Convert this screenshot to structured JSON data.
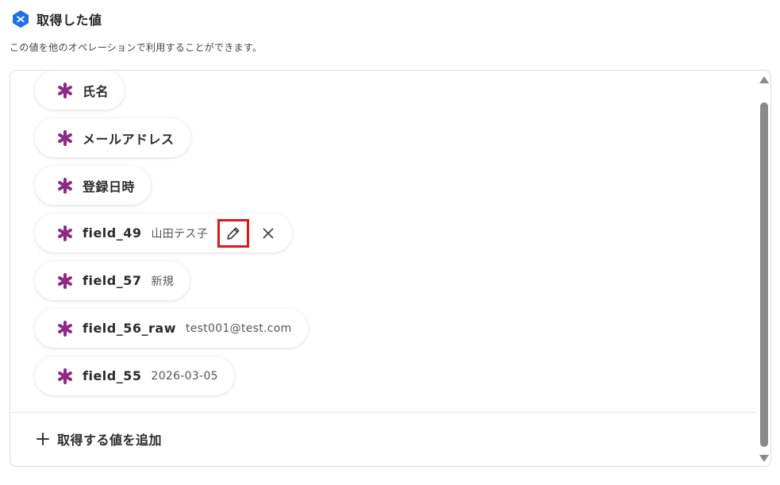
{
  "header": {
    "title": "取得した値",
    "description": "この値を他のオペレーションで利用することができます。",
    "icon": "hexagon-badge-icon",
    "accent_color": "#1f6fe5"
  },
  "values": [
    {
      "name": "氏名",
      "value": ""
    },
    {
      "name": "メールアドレス",
      "value": ""
    },
    {
      "name": "登録日時",
      "value": ""
    },
    {
      "name": "field_49",
      "value": "山田テス子",
      "hovered": true
    },
    {
      "name": "field_57",
      "value": "新規"
    },
    {
      "name": "field_56_raw",
      "value": "test001@test.com"
    },
    {
      "name": "field_55",
      "value": "2026-03-05"
    }
  ],
  "icons": {
    "value_icon": "asterisk-icon",
    "edit_icon": "pencil-icon",
    "delete_icon": "close-icon",
    "add_icon": "plus-icon"
  },
  "asterisk_color": "#8e2a86",
  "highlight_color": "#e0161e",
  "add_button": {
    "label": "取得する値を追加"
  }
}
